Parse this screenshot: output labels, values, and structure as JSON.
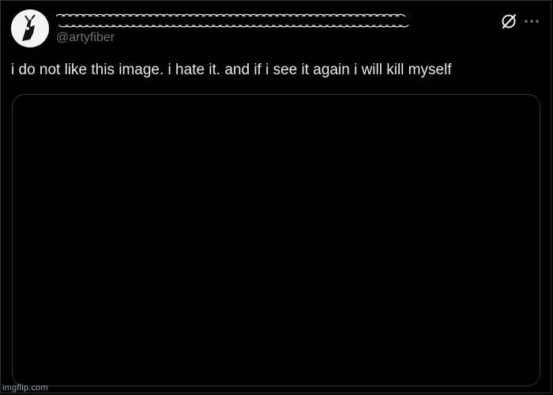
{
  "tweet": {
    "display_name": "͡ ͜ ͡ ͜ ͡ ͜ ͡ ͜ ͡ ͜ ͡ ͜ ͡ ͜ ͡ ͜ ͡ ͜ ͡ ͜ ͡ ͜ ͡ ͜ ͡ ͜ ͡ ͜ ͡ ͜ ͡ ͜ ͡ ͜ ͡ ͜ ͡ ͜ ͡ ͜ ͡ ͜ ͡ ͜ ͡ ͜ ͡ ͜ ͡ ͜ ͡ ͜ ͡ ͜ ͡ ͜ ͡ ͜ ͡ ͜ ͡ ͜ ͡ ͜ ͡ ͜ ͡ ͜ ͡ ͜ ͡ ͜ ͡ ͜ ͡ ͜ ͡ ͜ ͡ ͜ ͡ ͜ ͡ ͜ ͡ ͜ ͡ ͜ ͡ ͜ ͡ ͜ ͡ ͜ ͡ ͜ ͡ ͜ ͡ ͜ ͡ ͜ ͡ ͜",
    "handle": "@artyfiber",
    "text": "i do not like this image. i hate it. and if i see it again i will kill myself",
    "grok_icon": "grok-slash-circle-icon",
    "more_icon": "more-horizontal-icon"
  },
  "watermark": "imgflip.com",
  "colors": {
    "background": "#000000",
    "text_primary": "#e7e9ea",
    "text_secondary": "#71767b",
    "border": "#2f3336"
  }
}
